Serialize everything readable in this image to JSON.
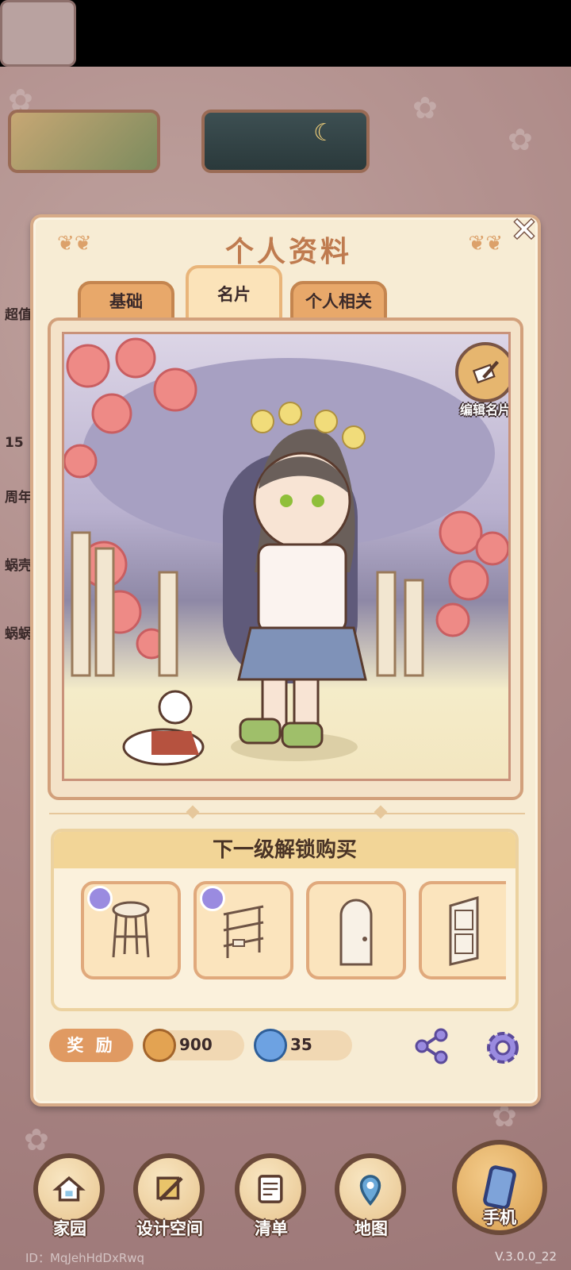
{
  "dialog": {
    "title": "个人资料",
    "tabs": [
      {
        "label": "基础",
        "active": false
      },
      {
        "label": "名片",
        "active": true
      },
      {
        "label": "个人相关",
        "active": false
      }
    ],
    "edit_card_label": "编辑名片",
    "unlock_title": "下一级解锁购买",
    "unlock_items": [
      {
        "icon": "stool-icon",
        "badge": true
      },
      {
        "icon": "shelf-icon",
        "badge": true
      },
      {
        "icon": "arched-door-icon",
        "badge": false
      },
      {
        "icon": "door-icon",
        "badge": false
      }
    ],
    "reward_label": "奖 励",
    "coins": "900",
    "gems": "35"
  },
  "background": {
    "left_labels": [
      "超值",
      "15",
      "周年",
      "蜗壳",
      "蜗蜗"
    ]
  },
  "nav": [
    {
      "label": "家园",
      "icon": "house-icon"
    },
    {
      "label": "设计空间",
      "icon": "design-icon"
    },
    {
      "label": "清单",
      "icon": "list-icon"
    },
    {
      "label": "地图",
      "icon": "map-pin-icon"
    },
    {
      "label": "手机",
      "icon": "phone-icon"
    }
  ],
  "footer": {
    "id": "ID：MqJehHdDxRwq",
    "version": "V.3.0.0_22"
  },
  "colors": {
    "accent": "#e09a62",
    "title": "#bf7b4f",
    "panel": "#f7ecd4"
  }
}
